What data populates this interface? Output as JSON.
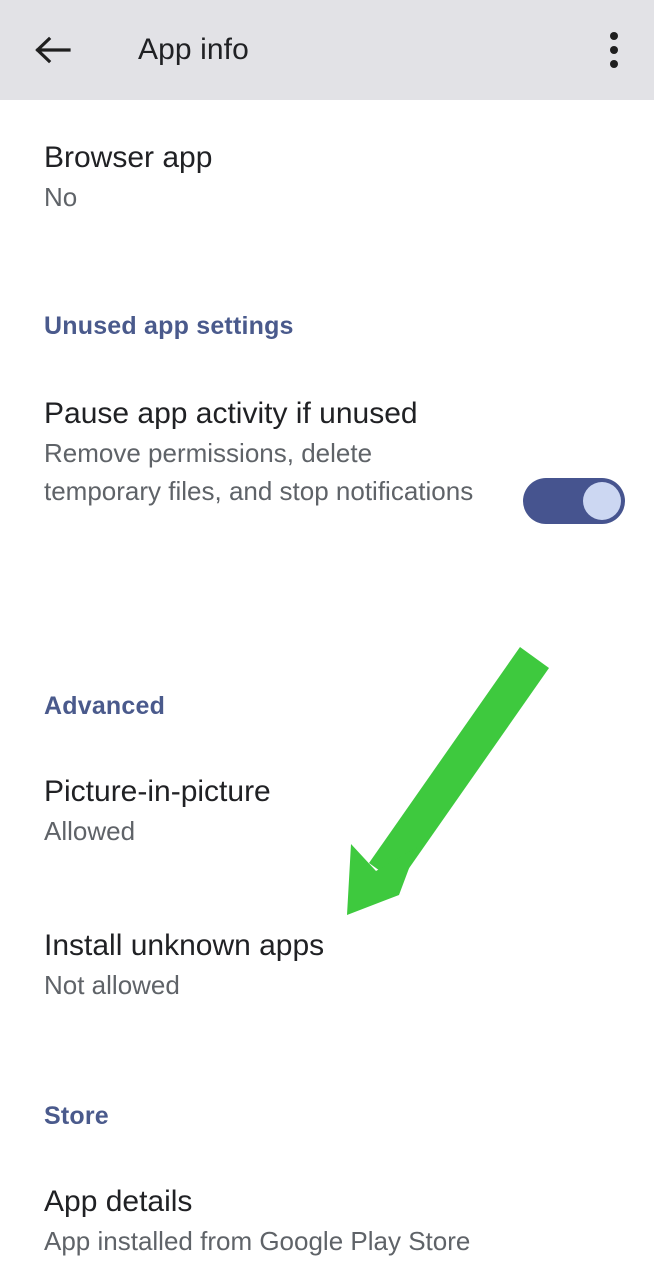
{
  "header": {
    "title": "App info",
    "back_icon": "arrow-left-icon",
    "overflow_icon": "more-vert-icon"
  },
  "colors": {
    "appbar_background": "#e2e2e6",
    "page_background": "#ffffff",
    "title_text": "#202124",
    "subtitle_text": "#5f6368",
    "section_header": "#4a5a8c",
    "toggle_track_on": "#46548f",
    "toggle_thumb_on": "#ccd7f2",
    "annotation_arrow": "#3ec93e"
  },
  "rows": {
    "browser_app": {
      "title": "Browser app",
      "value": "No"
    },
    "pause_app_activity": {
      "title": "Pause app activity if unused",
      "value": "Remove permissions, delete temporary files, and stop notifications",
      "toggle_state": "on"
    },
    "picture_in_picture": {
      "title": "Picture-in-picture",
      "value": "Allowed"
    },
    "install_unknown_apps": {
      "title": "Install unknown apps",
      "value": "Not allowed"
    },
    "app_details": {
      "title": "App details",
      "value": "App installed from Google Play Store"
    }
  },
  "sections": {
    "unused_app_settings": "Unused app settings",
    "advanced": "Advanced",
    "store": "Store"
  },
  "annotation": {
    "type": "arrow",
    "points_to": "Install unknown apps",
    "color": "#3ec93e"
  }
}
